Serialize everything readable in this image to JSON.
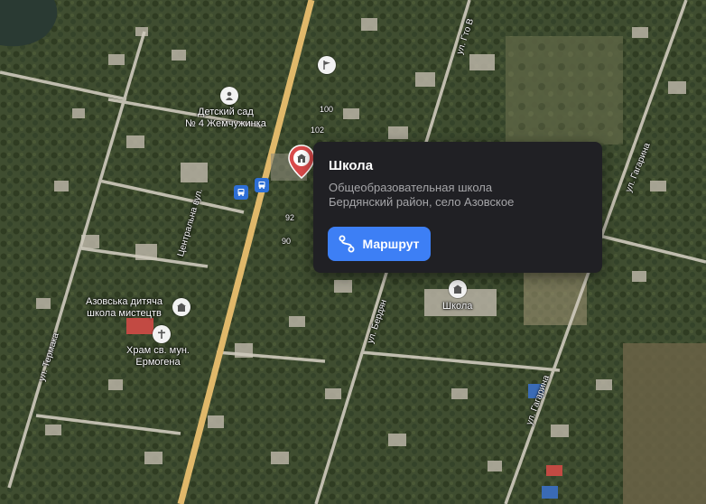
{
  "map": {
    "labels": {
      "kindergarten": "Детский сад\n№ 4 Жемчужинка",
      "art_school": "Азовська дитяча\nшкола мистецтв",
      "church": "Храм св. мун.\nЕрмогена",
      "school_map_label": "Школа"
    },
    "streets": {
      "tsentralna": "Центральна вул.",
      "lenina_right": "ул. Гагарина",
      "top_street": "ул. Гто В",
      "termaka": "ул. Термака",
      "middle": "ул. Бердян",
      "bottom_right": "ул. Гагарина"
    },
    "house_numbers": {
      "n100": "100",
      "n102": "102",
      "n92": "92",
      "n90": "90"
    },
    "icons": {
      "kindergarten": "kindergarten-icon",
      "flag": "flag-icon",
      "school": "school-icon",
      "art_school": "art-school-icon",
      "church": "church-icon",
      "bus_stop": "bus-stop-icon",
      "route": "route-icon"
    }
  },
  "place_card": {
    "title": "Школа",
    "subtitle_line1": "Общеобразовательная школа",
    "subtitle_line2": "Бердянский район, село Азовское",
    "route_button_label": "Маршрут"
  },
  "colors": {
    "card_background": "#202024",
    "route_button": "#3d7ff5",
    "main_road": "#e0b86a"
  }
}
